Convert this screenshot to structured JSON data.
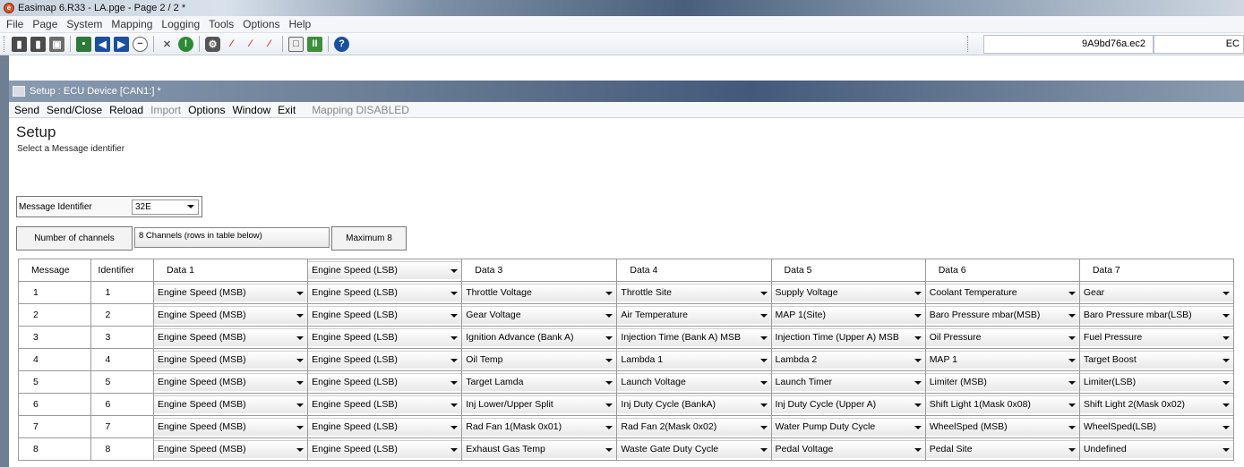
{
  "window_title": "Easimap 6.R33 - LA.pge - Page 2 / 2 *",
  "menu": [
    "File",
    "Page",
    "System",
    "Mapping",
    "Logging",
    "Tools",
    "Options",
    "Help"
  ],
  "toolbar": {
    "ecu_id": "9A9bd76a.ec2",
    "ecu_id2": "EC"
  },
  "child_window": {
    "title": "Setup : ECU Device [CAN1:] *",
    "menu": [
      "Send",
      "Send/Close",
      "Reload",
      "Import",
      "Options",
      "Window",
      "Exit",
      "Mapping DISABLED"
    ]
  },
  "setup": {
    "title": "Setup",
    "subtitle": "Select a Message identifier",
    "message_identifier_label": "Message Identifier",
    "message_identifier_value": "32E",
    "channels_label": "Number of channels",
    "channels_value": "8 Channels (rows in table below)",
    "maximum_label": "Maximum 8"
  },
  "table": {
    "headers": [
      "Message",
      "Identifier",
      "Data 1",
      "Engine Speed (LSB)",
      "Data 3",
      "Data 4",
      "Data 5",
      "Data 6",
      "Data 7"
    ],
    "rows": [
      {
        "message": "1",
        "identifier": "1",
        "cells": [
          "Engine Speed (MSB)",
          "Engine Speed (LSB)",
          "Throttle Voltage",
          "Throttle Site",
          "Supply Voltage",
          "Coolant Temperature",
          "Gear"
        ]
      },
      {
        "message": "2",
        "identifier": "2",
        "cells": [
          "Engine Speed (MSB)",
          "Engine Speed (LSB)",
          "Gear Voltage",
          "Air Temperature",
          "MAP 1(Site)",
          "Baro Pressure mbar(MSB)",
          "Baro Pressure mbar(LSB)"
        ]
      },
      {
        "message": "3",
        "identifier": "3",
        "cells": [
          "Engine Speed (MSB)",
          "Engine Speed (LSB)",
          "Ignition Advance (Bank A)",
          "Injection Time (Bank A) MSB",
          "Injection Time (Upper A) MSB",
          "Oil Pressure",
          "Fuel Pressure"
        ]
      },
      {
        "message": "4",
        "identifier": "4",
        "cells": [
          "Engine Speed (MSB)",
          "Engine Speed (LSB)",
          "Oil Temp",
          "Lambda 1",
          "Lambda 2",
          "MAP 1",
          "Target Boost"
        ]
      },
      {
        "message": "5",
        "identifier": "5",
        "cells": [
          "Engine Speed (MSB)",
          "Engine Speed (LSB)",
          "Target Lamda",
          "Launch Voltage",
          "Launch Timer",
          "Limiter (MSB)",
          "Limiter(LSB)"
        ]
      },
      {
        "message": "6",
        "identifier": "6",
        "cells": [
          "Engine Speed (MSB)",
          "Engine Speed (LSB)",
          "Inj Lower/Upper Split",
          "Inj Duty Cycle (BankA)",
          "Inj Duty Cycle (Upper A)",
          "Shift Light 1(Mask 0x08)",
          "Shift Light 2(Mask 0x02)"
        ]
      },
      {
        "message": "7",
        "identifier": "7",
        "cells": [
          "Engine Speed (MSB)",
          "Engine Speed (LSB)",
          "Rad Fan 1(Mask 0x01)",
          "Rad Fan 2(Mask 0x02)",
          "Water Pump Duty Cycle",
          "WheelSped (MSB)",
          "WheelSped(LSB)"
        ]
      },
      {
        "message": "8",
        "identifier": "8",
        "cells": [
          "Engine Speed (MSB)",
          "Engine Speed (LSB)",
          "Exhaust Gas Temp",
          "Waste Gate Duty Cycle",
          "Pedal Voltage",
          "Pedal Site",
          "Undefined"
        ]
      }
    ]
  }
}
